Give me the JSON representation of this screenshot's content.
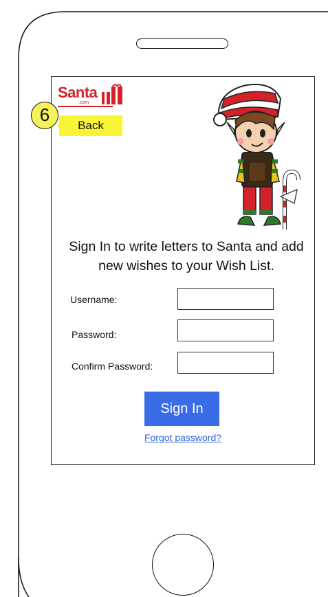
{
  "annotation": {
    "step": "6",
    "back_label": "Back"
  },
  "logo": {
    "name": "Santa",
    "suffix": ".com"
  },
  "intro_text": "Sign In to write letters to Santa and add new wishes to your Wish List.",
  "form": {
    "fields": [
      {
        "label": "Username:",
        "value": ""
      },
      {
        "label": "Password:",
        "value": ""
      },
      {
        "label": "Confirm Password:",
        "value": ""
      }
    ],
    "submit_label": "Sign In",
    "forgot_label": "Forgot password?"
  },
  "colors": {
    "brand": "#d4222a",
    "accent": "#3b6ce8",
    "link": "#2c64e0",
    "note": "#f9f536"
  }
}
